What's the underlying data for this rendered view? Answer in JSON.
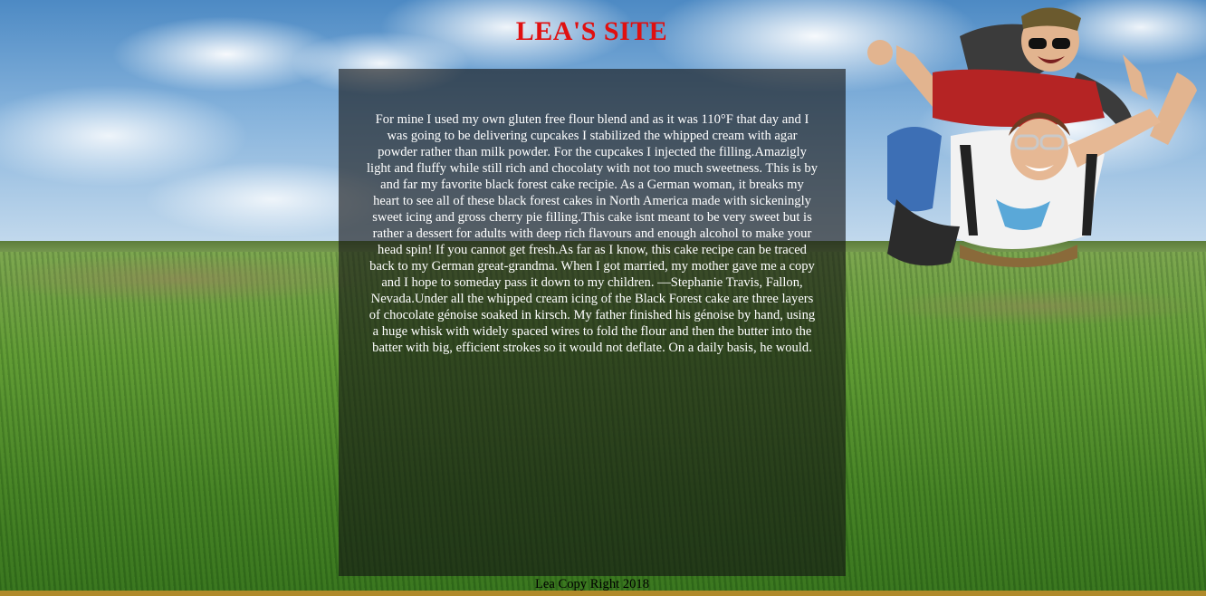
{
  "header": {
    "title": "LEA'S SITE"
  },
  "main": {
    "body_text": "For mine I used my own gluten free flour blend and as it was 110°F that day and I was going to be delivering cupcakes I stabilized the whipped cream with agar powder rather than milk powder. For the cupcakes I injected the filling.Amazigly light and fluffy while still rich and chocolaty with not too much sweetness. This is by and far my favorite black forest cake recipie. As a German woman, it breaks my heart to see all of these black forest cakes in North America made with sickeningly sweet icing and gross cherry pie filling.This cake isnt meant to be very sweet but is rather a dessert for adults with deep rich flavours and enough alcohol to make your head spin! If you cannot get fresh.As far as I know, this cake recipe can be traced back to my German great-grandma. When I got married, my mother gave me a copy and I hope to someday pass it down to my children. —Stephanie Travis, Fallon, Nevada.Under all the whipped cream icing of the Black Forest cake are three layers of chocolate génoise soaked in kirsch. My father finished his génoise by hand, using a huge whisk with widely spaced wires to fold the flour and then the butter into the batter with big, efficient strokes so it would not deflate. On a daily basis, he would."
  },
  "footer": {
    "text": "Lea Copy Right 2018"
  },
  "images": {
    "background": "grass-field-sky-image",
    "corner": "tandem-skydivers-image"
  },
  "colors": {
    "title": "#e01010",
    "panel": "rgba(20,20,20,0.62)",
    "body_text": "#ffffff",
    "footer_text": "#000000"
  }
}
